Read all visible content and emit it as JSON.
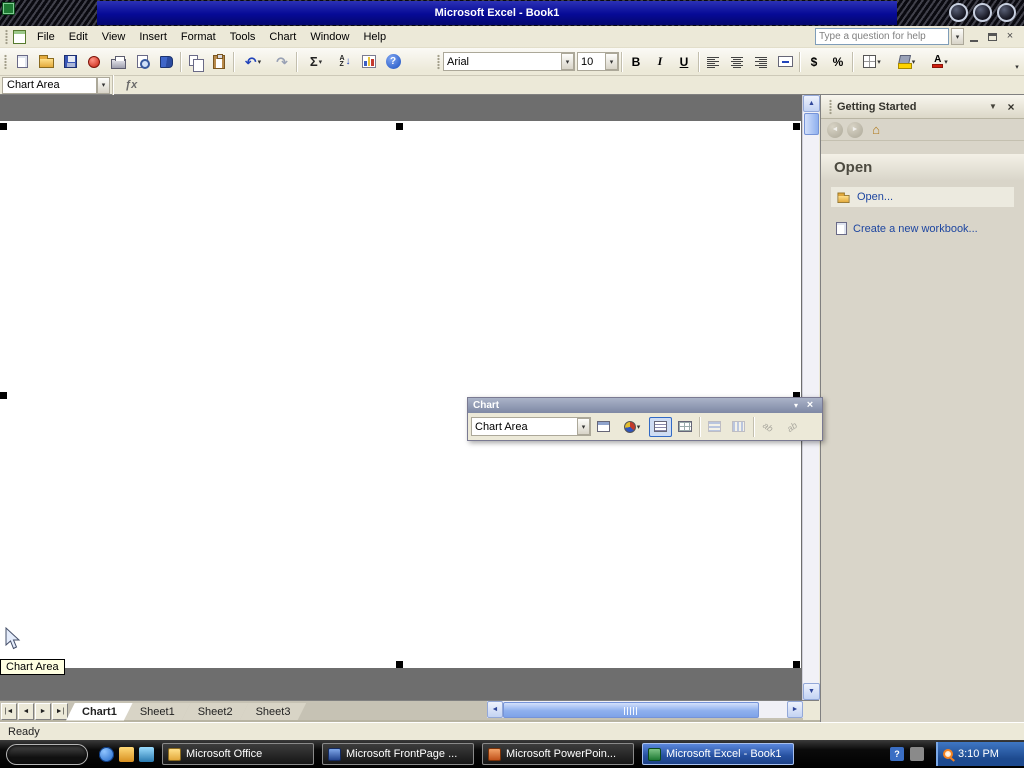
{
  "colors": {
    "titlebar_blue": "#060a96",
    "chrome_beige": "#ece9d8",
    "chart_sheet_gray": "#6e6e6e",
    "tooltip_yellow": "#ffffe1",
    "link_blue": "#1e46a0",
    "taskbar_black": "#000000",
    "active_task_blue": "#26509f",
    "scrollbar_thumb_blue": "#8fb0ee",
    "selection_handle_black": "#000000",
    "font_color_red": "#d02010",
    "fill_color_yellow": "#ffd400"
  },
  "titlebar": {
    "title": "Microsoft Excel - Book1"
  },
  "menubar": {
    "items": [
      "File",
      "Edit",
      "View",
      "Insert",
      "Format",
      "Tools",
      "Chart",
      "Window",
      "Help"
    ],
    "question_placeholder": "Type a question for help"
  },
  "toolbar": {
    "font_name": "Arial",
    "font_size": "10",
    "bold": "B",
    "italic": "I",
    "underline": "U",
    "currency": "$",
    "percent": "%",
    "font_color_letter": "A"
  },
  "formula_bar": {
    "name_box": "Chart Area",
    "fx": "ƒx"
  },
  "chart_toolbar": {
    "title": "Chart",
    "selector": "Chart Area"
  },
  "chart_sheet": {
    "tooltip": "Chart Area"
  },
  "sheet_tabs": {
    "tabs": [
      {
        "label": "Chart1",
        "active": true
      },
      {
        "label": "Sheet1",
        "active": false
      },
      {
        "label": "Sheet2",
        "active": false
      },
      {
        "label": "Sheet3",
        "active": false
      }
    ]
  },
  "task_pane": {
    "title": "Getting Started",
    "section_heading": "Open",
    "links": [
      {
        "label": "Open..."
      },
      {
        "label": "Create a new workbook..."
      }
    ]
  },
  "status_bar": {
    "message": "Ready"
  },
  "taskbar": {
    "tasks": [
      {
        "label": "Microsoft Office",
        "active": false
      },
      {
        "label": "Microsoft FrontPage ...",
        "active": false
      },
      {
        "label": "Microsoft PowerPoin...",
        "active": false
      },
      {
        "label": "Microsoft Excel - Book1",
        "active": true
      }
    ],
    "clock": "3:10 PM"
  },
  "glyphs": {
    "dropdown": "▾",
    "down_big": "▼",
    "close": "×",
    "up": "▲",
    "down": "▼",
    "left": "◄",
    "right": "►",
    "tab_first": "|◄",
    "tab_prev": "◄",
    "tab_next": "►",
    "tab_last": "►|",
    "undo": "↶",
    "redo": "↷",
    "autosum": "Σ",
    "sort_a": "A",
    "sort_z": "Z",
    "sort_arrow": "↓",
    "help": "?",
    "home": "⌂",
    "back": "◄",
    "forward": "►",
    "angle_text": "ab"
  }
}
